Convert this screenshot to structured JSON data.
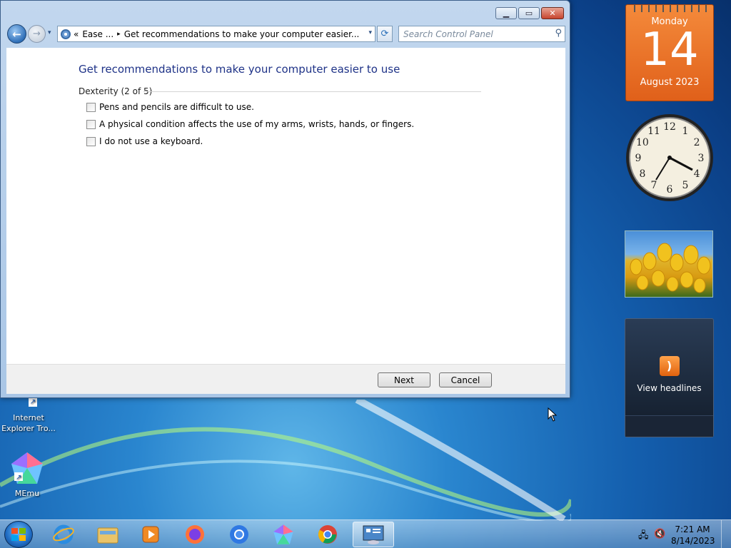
{
  "window": {
    "controls": {
      "minimize": "▁",
      "maximize": "▭",
      "close": "✕"
    },
    "nav": {
      "back": "←",
      "forward": "→",
      "dropdown": "▾"
    },
    "address": {
      "prefix": "«",
      "crumb1": "Ease ...",
      "separator": "▸",
      "crumb2": "Get recommendations to make your computer easier...",
      "dropdown": "▾"
    },
    "refresh": "⟳",
    "search": {
      "placeholder": "Search Control Panel",
      "icon": "⚲"
    },
    "page_title": "Get recommendations to make your computer easier to use",
    "group_title": "Dexterity (2 of 5)",
    "options": [
      "Pens and pencils are difficult to use.",
      "A physical condition affects the use of my arms, wrists, hands, or fingers.",
      "I do not use a keyboard."
    ],
    "buttons": {
      "next": "Next",
      "cancel": "Cancel"
    }
  },
  "desktop": {
    "icons": [
      {
        "label": "Internet Explorer Tro...",
        "name": "internet-explorer"
      },
      {
        "label": "MEmu",
        "name": "memu"
      }
    ]
  },
  "gadgets": {
    "calendar": {
      "weekday": "Monday",
      "day": "14",
      "month_year": "August 2023"
    },
    "clock": {
      "numbers": [
        "12",
        "1",
        "2",
        "3",
        "4",
        "5",
        "6",
        "7",
        "8",
        "9",
        "10",
        "11"
      ]
    },
    "feed": {
      "icon": "rss-icon",
      "label": "View headlines"
    }
  },
  "taskbar": {
    "items": [
      "start",
      "internet-explorer",
      "file-explorer",
      "media-player",
      "firefox",
      "chromium",
      "memu",
      "chrome",
      "control-panel"
    ],
    "clock": {
      "time": "7:21 AM",
      "date": "8/14/2023"
    }
  }
}
